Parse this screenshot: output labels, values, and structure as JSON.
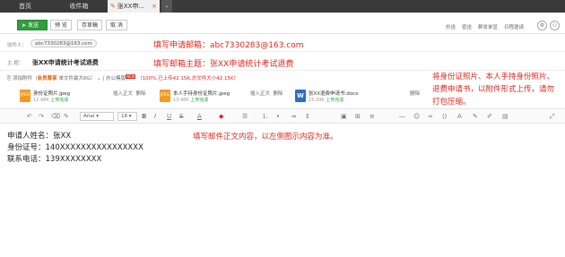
{
  "tabs": [
    {
      "label": "首页"
    },
    {
      "label": "收件箱"
    },
    {
      "label": "张XX申..."
    }
  ],
  "tab_close": "×",
  "tab_dropdown": "⌄",
  "toolbar": {
    "send": "发送",
    "preview": "预 览",
    "draft": "存草稿",
    "cancel": "取 消",
    "right_links": [
      "抄送",
      "密送",
      "群发单显",
      "日程邀请"
    ]
  },
  "recipient": {
    "label": "收件人：",
    "address": "abc7330283@163.com",
    "annotation": "填写申请邮箱：abc7330283@163.com"
  },
  "subject": {
    "label": "主 题：",
    "value": "张XX申请统计考试退费",
    "annotation": "填写邮箱主题：张XX申请统计考试退费"
  },
  "attach_bar": {
    "prefix": "添加附件（",
    "vip": "会员尊享",
    "vip_text": "单文件最大6G",
    "suffix": "）",
    "office": "办公模版",
    "new_badge": "NEW",
    "capacity": "（100%,已上传42.15K,总文件大小42.15K）"
  },
  "attach_annotation": [
    "将身份证照片、本人手持身份照片、",
    "退费申请书，以附件形式上传，请勿",
    "打包压缩。"
  ],
  "attachments": [
    {
      "type": "JPEG",
      "name": "身份证照片.jpeg",
      "size": "12.48K",
      "status": "上传完成",
      "insert": "插入正文",
      "del": "删除",
      "color": "#f29a1f"
    },
    {
      "type": "JPEG",
      "name": "本人手持身份证照片.jpeg",
      "size": "13.48K",
      "status": "上传完成",
      "insert": "插入正文",
      "del": "删除",
      "color": "#f29a1f"
    },
    {
      "type": "W",
      "name": "张XX退费申请书.docx",
      "size": "15.29K",
      "status": "上传完成",
      "del": "删除",
      "color": "#2b6fc9"
    }
  ],
  "editor": {
    "font": "Arial",
    "size": "18"
  },
  "body_lines": [
    "申请人姓名：张XX",
    "身份证号：140XXXXXXXXXXXXXXXX",
    "联系电话：139XXXXXXXX"
  ],
  "body_annotation": "填写邮件正文内容，以左侧图示内容为准。"
}
